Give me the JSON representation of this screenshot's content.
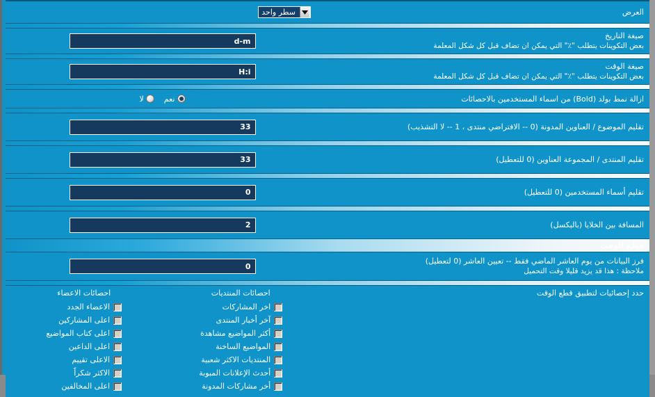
{
  "display_row": {
    "label": "العرض",
    "select_value": "سطر واحد"
  },
  "settings": [
    {
      "label": "صيغة التاريخ",
      "sub": "بعض التكوينات يتطلب \"٪\" التي يمكن ان تضاف قبل كل شكل المعلمة",
      "value": "d-m"
    },
    {
      "label": "صيغة الوقت",
      "sub": "بعض التكوينات يتطلب \"٪\" التي يمكن ان تضاف قبل كل شكل المعلمة",
      "value": "H:i"
    }
  ],
  "bold_row": {
    "label": "ازالة نمط بولد (Bold) من اسماء المستخدمين بالاحصائات",
    "options": [
      {
        "label": "نعم",
        "selected": true
      },
      {
        "label": "لا",
        "selected": false
      }
    ]
  },
  "numeric_rows": [
    {
      "label": "تقليم الموضوع / العناوين المدونة (0 -- الافتراضي منتدى ، 1 -- لا التشذيب)",
      "value": "33"
    },
    {
      "label": "تقليم المنتدى / المجموعة العناوين (0 للتعطيل)",
      "value": "33"
    },
    {
      "label": "تقليم أسماء المستخدمين (0 للتعطيل)",
      "value": "0"
    },
    {
      "label": "المسافة بين الخلايا (بالبكسل)",
      "value": "2"
    }
  ],
  "timecut_section": {
    "title": "قطع الوقت",
    "row": {
      "label": "فرز البيانات من يوم العاشر الماضي فقط -- تعيين العاشر (0 لتعطيل)",
      "sub": "ملاحظة : هذا قد يزيد قليلا وقت التحميل",
      "value": "0"
    },
    "stats_label": "حدد إحصائيات لتطبيق قطع الوقت",
    "columns": [
      {
        "header": "احصائات المنتديات",
        "items": [
          {
            "label": "اخر المشاركات",
            "checked": false
          },
          {
            "label": "آخر أخبار المنتدى",
            "checked": false
          },
          {
            "label": "أكثر المواضيع مشاهدة",
            "checked": false
          },
          {
            "label": "المواضيع الساخنة",
            "checked": false
          },
          {
            "label": "المنتديات الاكثر شعبية",
            "checked": false
          },
          {
            "label": "أحدث الإعلانات المبوبة",
            "checked": false
          },
          {
            "label": "أخر مشاركات المدونة",
            "checked": false
          }
        ]
      },
      {
        "header": "احصائات الاعضاء",
        "items": [
          {
            "label": "الاعضاء الجدد",
            "checked": false
          },
          {
            "label": "اعلى المشاركين",
            "checked": false
          },
          {
            "label": "اعلى كتاب المواضيع",
            "checked": false
          },
          {
            "label": "اعلى الداعين",
            "checked": false
          },
          {
            "label": "الاعلى تقييم",
            "checked": false
          },
          {
            "label": "الاكثر شكراً",
            "checked": false
          },
          {
            "label": "اعلى المخالفين",
            "checked": false
          }
        ]
      }
    ]
  },
  "icons": {
    "dropdown_arrow": "chevron-down-icon"
  },
  "colors": {
    "panel_blue": "#0f93c8",
    "input_navy": "#163a5e",
    "border_dark": "#0a5f83"
  }
}
